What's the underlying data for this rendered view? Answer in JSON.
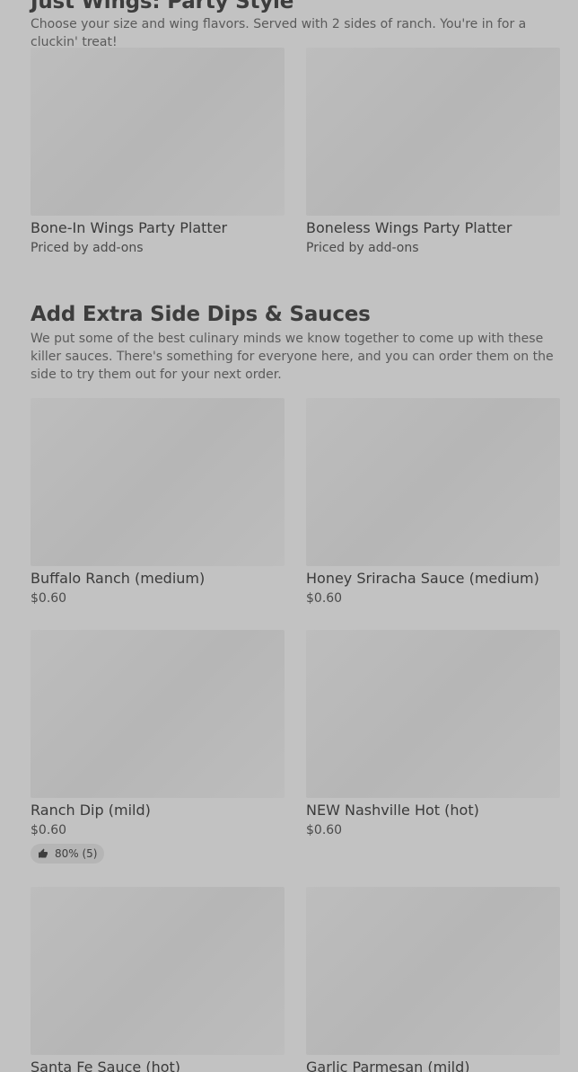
{
  "sections": [
    {
      "title": "Just Wings: Party Style",
      "description": "Choose your size and wing flavors. Served with 2 sides of ranch. You're in for a cluckin' treat!",
      "items": [
        {
          "name": "Bone-In Wings Party Platter",
          "price": "Priced by add-ons"
        },
        {
          "name": "Boneless Wings Party Platter",
          "price": "Priced by add-ons"
        }
      ]
    },
    {
      "title": "Add Extra Side Dips & Sauces",
      "description": "We put some of the best culinary minds we know together to come up with these killer sauces. There's something for everyone here, and you can order them on the side to try them out for your next order.",
      "items": [
        {
          "name": "Buffalo Ranch (medium)",
          "price": "$0.60"
        },
        {
          "name": "Honey Sriracha Sauce (medium)",
          "price": "$0.60"
        },
        {
          "name": "Ranch Dip (mild)",
          "price": "$0.60",
          "rating": "80% (5)",
          "rating_icon": "thumbs-up-icon"
        },
        {
          "name": "NEW Nashville Hot (hot)",
          "price": "$0.60"
        },
        {
          "name": "Santa Fe Sauce (hot)",
          "price": ""
        },
        {
          "name": "Garlic Parmesan (mild)",
          "price": ""
        }
      ]
    }
  ]
}
